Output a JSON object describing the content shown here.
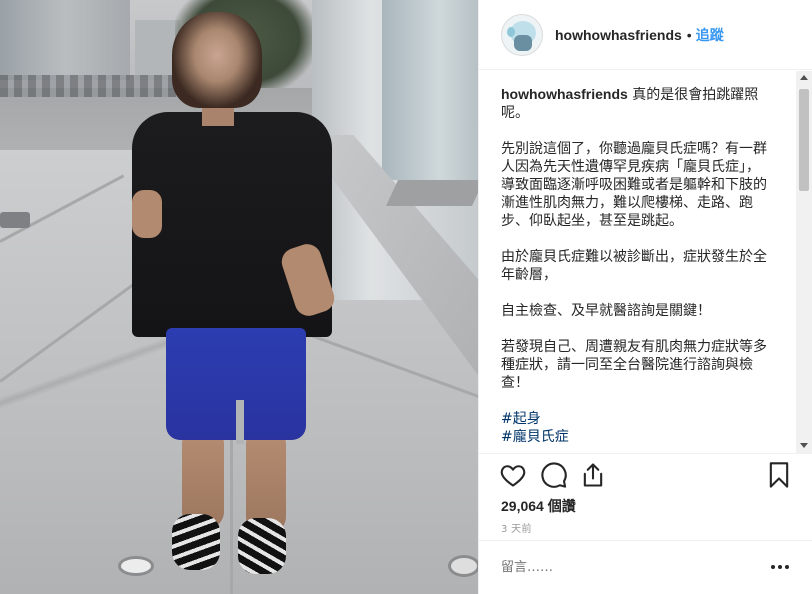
{
  "post": {
    "username": "howhowhasfriends",
    "separator": "•",
    "follow_label": "追蹤",
    "caption": {
      "user": "howhowhasfriends",
      "first": " 真的是很會拍跳躍照呢。",
      "p1": "先別說這個了，你聽過龐貝氏症嗎？有一群人因為先天性遺傳罕見疾病「龐貝氏症」，導致面臨逐漸呼吸困難或者是軀幹和下肢的漸進性肌肉無力，難以爬樓梯、走路、跑步、仰臥起坐，甚至是跳起。",
      "p2": "由於龐貝氏症難以被診斷出，症狀發生於全年齡層，",
      "p3": "自主檢查、及早就醫諮詢是關鍵！",
      "p4": "若發現自己、周遭親友有肌肉無力症狀等多種症狀，請一同至全台醫院進行諮詢與檢查！",
      "tag1": "#起身",
      "tag2": "#龐貝氏症"
    },
    "likes": "29,064 個讚",
    "time": "3 天前",
    "comment_placeholder": "留言……"
  },
  "icons": {
    "avatar": "avatar",
    "like": "heart-icon",
    "comment": "comment-icon",
    "share": "share-icon",
    "save": "bookmark-icon",
    "more": "more-options-icon"
  },
  "colors": {
    "follow": "#3897f0",
    "text": "#262626",
    "muted": "#999999",
    "hashtag": "#003569"
  }
}
